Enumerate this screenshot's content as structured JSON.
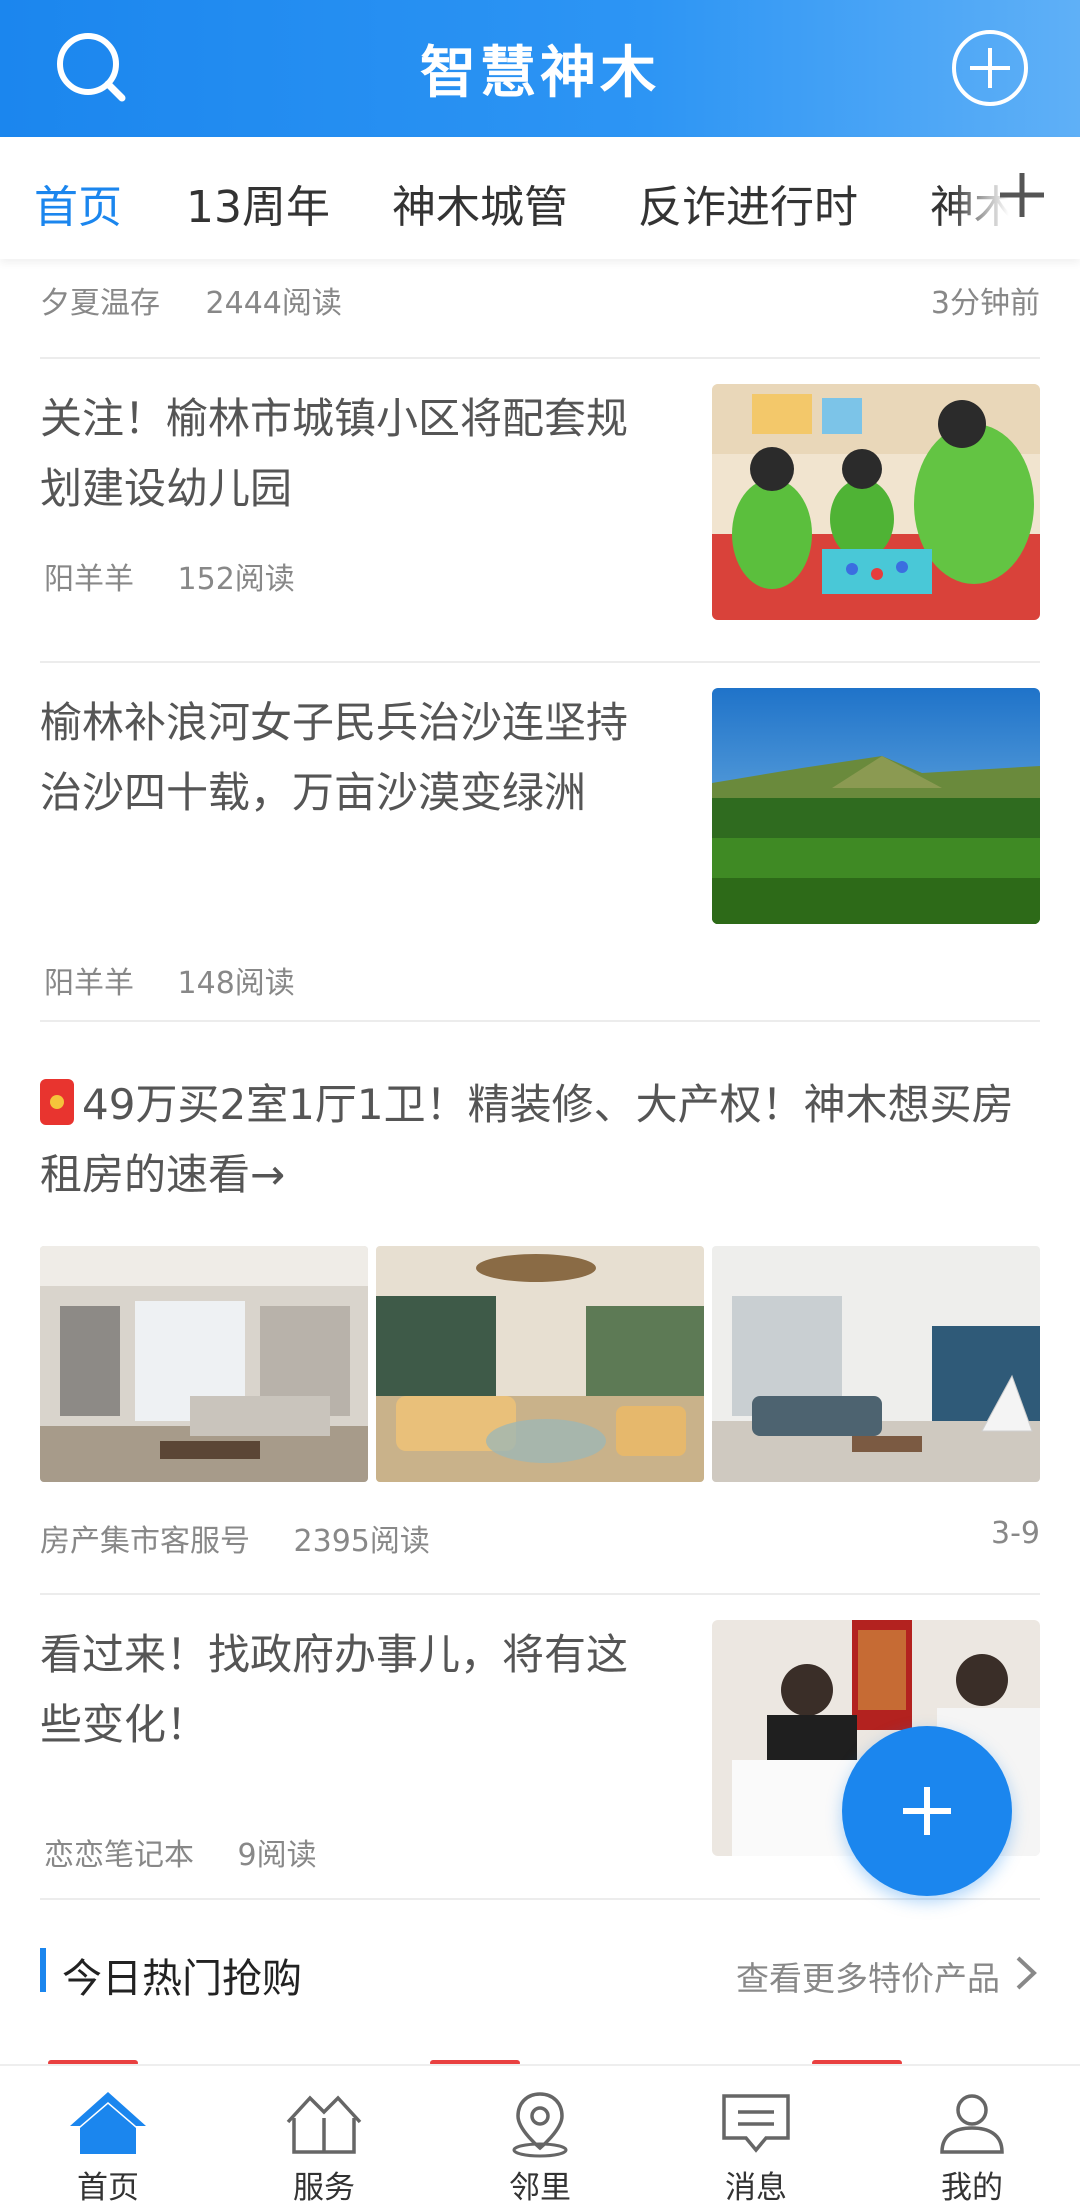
{
  "header": {
    "title": "智慧神木"
  },
  "tabs": [
    "首页",
    "13周年",
    "神木城管",
    "反诈进行时",
    "神木"
  ],
  "top_row": {
    "author": "夕夏温存",
    "reads": "2444阅读",
    "time": "3分钟前"
  },
  "articles": [
    {
      "title": "关注！榆林市城镇小区将配套规划建设幼儿园",
      "author": "阳羊羊",
      "reads": "152阅读"
    },
    {
      "title": "榆林补浪河女子民兵治沙连坚持治沙四十载，万亩沙漠变绿洲",
      "author": "阳羊羊",
      "reads": "148阅读"
    },
    {
      "title": "看过来！找政府办事儿，将有这些变化！",
      "author": "恋恋笔记本",
      "reads": "9阅读"
    }
  ],
  "promo": {
    "title": "49万买2室1厅1卫！精装修、大产权！神木想买房租房的速看→",
    "author": "房产集市客服号",
    "reads": "2395阅读",
    "date": "3-9"
  },
  "hot": {
    "title": "今日热门抢购",
    "more": "查看更多特价产品"
  },
  "bottom_nav": [
    "首页",
    "服务",
    "邻里",
    "消息",
    "我的"
  ],
  "colors": {
    "brand": "#1b86ee",
    "text": "#333333",
    "meta": "#888888"
  }
}
